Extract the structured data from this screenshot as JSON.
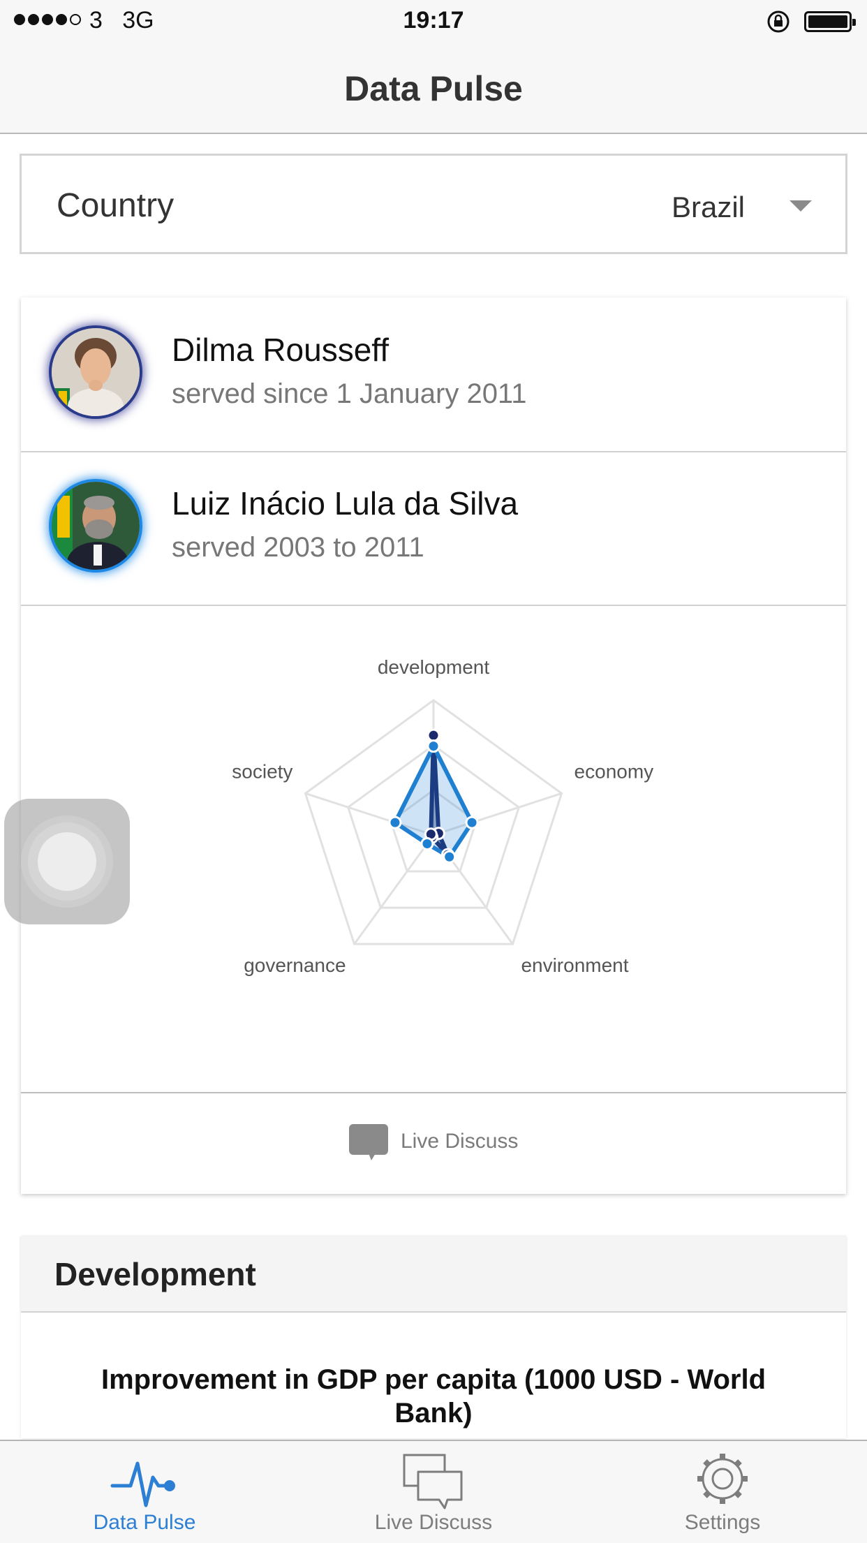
{
  "status_bar": {
    "carrier": "3",
    "network": "3G",
    "time": "19:17"
  },
  "nav": {
    "title": "Data Pulse"
  },
  "country_selector": {
    "label": "Country",
    "value": "Brazil"
  },
  "leaders": [
    {
      "name": "Dilma Rousseff",
      "term": "served since 1 January 2011",
      "ring_color": "#2a3b8a"
    },
    {
      "name": "Luiz Inácio Lula da Silva",
      "term": "served 2003 to 2011",
      "ring_color": "#1e88e5"
    }
  ],
  "chart_data": {
    "type": "radar",
    "axes": [
      "development",
      "economy",
      "environment",
      "governance",
      "society"
    ],
    "range": [
      0,
      5
    ],
    "grid_levels": 3,
    "series": [
      {
        "values": [
          3.7,
          0.2,
          0.9,
          0.1,
          0.1
        ],
        "color": "#1a2a6c"
      },
      {
        "values": [
          3.3,
          1.5,
          1.0,
          0.4,
          1.5
        ],
        "color": "#1f7fd0"
      }
    ]
  },
  "card_actions": {
    "discuss_label": "Live Discuss"
  },
  "section": {
    "title": "Development",
    "metric_title": "Improvement in GDP per capita (1000 USD - World Bank)"
  },
  "tabs": [
    {
      "label": "Data Pulse",
      "icon": "pulse-icon",
      "active": true
    },
    {
      "label": "Live Discuss",
      "icon": "chat-bubbles-icon",
      "active": false
    },
    {
      "label": "Settings",
      "icon": "gear-icon",
      "active": false
    }
  ],
  "colors": {
    "accent": "#2d7fd3",
    "series_dark": "#1a2a6c",
    "series_light": "#1f7fd0"
  }
}
